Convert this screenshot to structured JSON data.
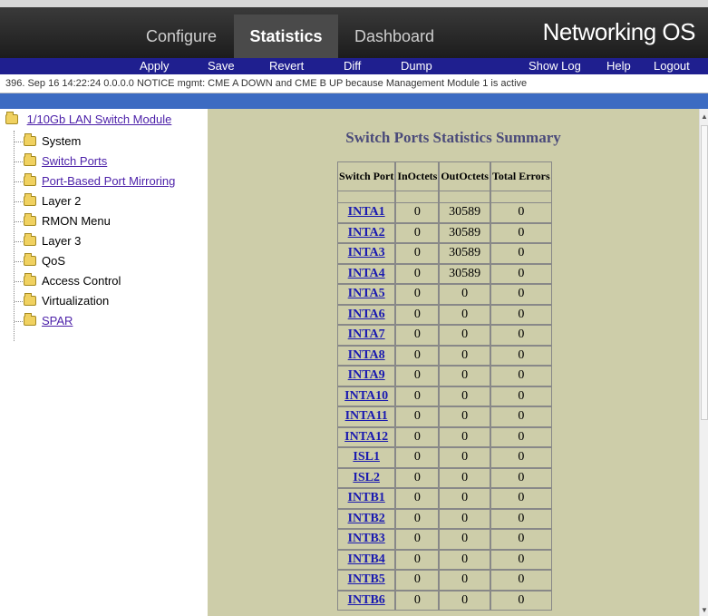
{
  "header": {
    "tabs": [
      "Configure",
      "Statistics",
      "Dashboard"
    ],
    "active_tab": "Statistics",
    "brand": "Networking OS"
  },
  "menubar": {
    "items": [
      "Apply",
      "Save",
      "Revert",
      "Diff",
      "Dump",
      "Show Log",
      "Help",
      "Logout"
    ]
  },
  "log_message": "396. Sep 16 14:22:24 0.0.0.0 NOTICE  mgmt: CME A DOWN and CME B UP because Management Module 1 is active",
  "sidebar": {
    "root": "1/10Gb LAN Switch Module",
    "items": [
      {
        "label": "System",
        "link": false
      },
      {
        "label": "Switch Ports",
        "link": true
      },
      {
        "label": "Port-Based Port Mirroring",
        "link": true
      },
      {
        "label": "Layer 2",
        "link": false
      },
      {
        "label": "RMON Menu",
        "link": false
      },
      {
        "label": "Layer 3",
        "link": false
      },
      {
        "label": "QoS",
        "link": false
      },
      {
        "label": "Access Control",
        "link": false
      },
      {
        "label": "Virtualization",
        "link": false
      },
      {
        "label": "SPAR",
        "link": true
      }
    ]
  },
  "main": {
    "title": "Switch Ports Statistics Summary",
    "columns": [
      "Switch Port",
      "InOctets",
      "OutOctets",
      "Total Errors"
    ],
    "rows": [
      [
        "INTA1",
        "0",
        "30589",
        "0"
      ],
      [
        "INTA2",
        "0",
        "30589",
        "0"
      ],
      [
        "INTA3",
        "0",
        "30589",
        "0"
      ],
      [
        "INTA4",
        "0",
        "30589",
        "0"
      ],
      [
        "INTA5",
        "0",
        "0",
        "0"
      ],
      [
        "INTA6",
        "0",
        "0",
        "0"
      ],
      [
        "INTA7",
        "0",
        "0",
        "0"
      ],
      [
        "INTA8",
        "0",
        "0",
        "0"
      ],
      [
        "INTA9",
        "0",
        "0",
        "0"
      ],
      [
        "INTA10",
        "0",
        "0",
        "0"
      ],
      [
        "INTA11",
        "0",
        "0",
        "0"
      ],
      [
        "INTA12",
        "0",
        "0",
        "0"
      ],
      [
        "ISL1",
        "0",
        "0",
        "0"
      ],
      [
        "ISL2",
        "0",
        "0",
        "0"
      ],
      [
        "INTB1",
        "0",
        "0",
        "0"
      ],
      [
        "INTB2",
        "0",
        "0",
        "0"
      ],
      [
        "INTB3",
        "0",
        "0",
        "0"
      ],
      [
        "INTB4",
        "0",
        "0",
        "0"
      ],
      [
        "INTB5",
        "0",
        "0",
        "0"
      ],
      [
        "INTB6",
        "0",
        "0",
        "0"
      ]
    ]
  },
  "colors": {
    "menubar": "#1f1f8f",
    "content_bg": "#cdcda9",
    "title": "#4a4a7a",
    "link": "#1a1ab0"
  }
}
